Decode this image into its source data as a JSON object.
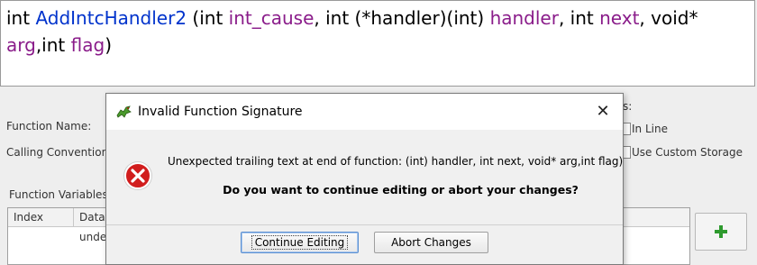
{
  "signature": {
    "return_type": "int",
    "function_name": "AddIntcHandler2",
    "t1": " (int ",
    "p1": "int_cause",
    "t2": ", int (*handler)(int) ",
    "p2": "handler",
    "t3": ", int ",
    "p3": "next",
    "t4": ", void*",
    "p4": "arg",
    "t5": ",int ",
    "p5": "flag",
    "t6": ")"
  },
  "background": {
    "function_name_label": "Function Name:",
    "calling_convention_label": "Calling Convention",
    "function_variables_label": "Function Variables",
    "partial_label_s": "s:",
    "inline_label": "In Line",
    "custom_storage_label": "Use Custom Storage",
    "table_columns": [
      "Index",
      "Datat"
    ],
    "table_cell": "unde"
  },
  "dialog": {
    "title": "Invalid Function Signature",
    "message": "Unexpected trailing text at end of function: (int) handler, int next, void* arg,int flag)",
    "question": "Do you want to continue editing or abort your changes?",
    "continue_label": "Continue Editing",
    "abort_label": "Abort Changes",
    "close_glyph": "✕"
  },
  "icons": {
    "title_icon": "ghidra-dragon-icon",
    "error_icon": "error-x-icon",
    "add_icon": "plus-icon"
  },
  "colors": {
    "function_name": "#0033cc",
    "params": "#8a1c8a",
    "error_red": "#d11d1d",
    "add_green": "#2e9a2e"
  }
}
